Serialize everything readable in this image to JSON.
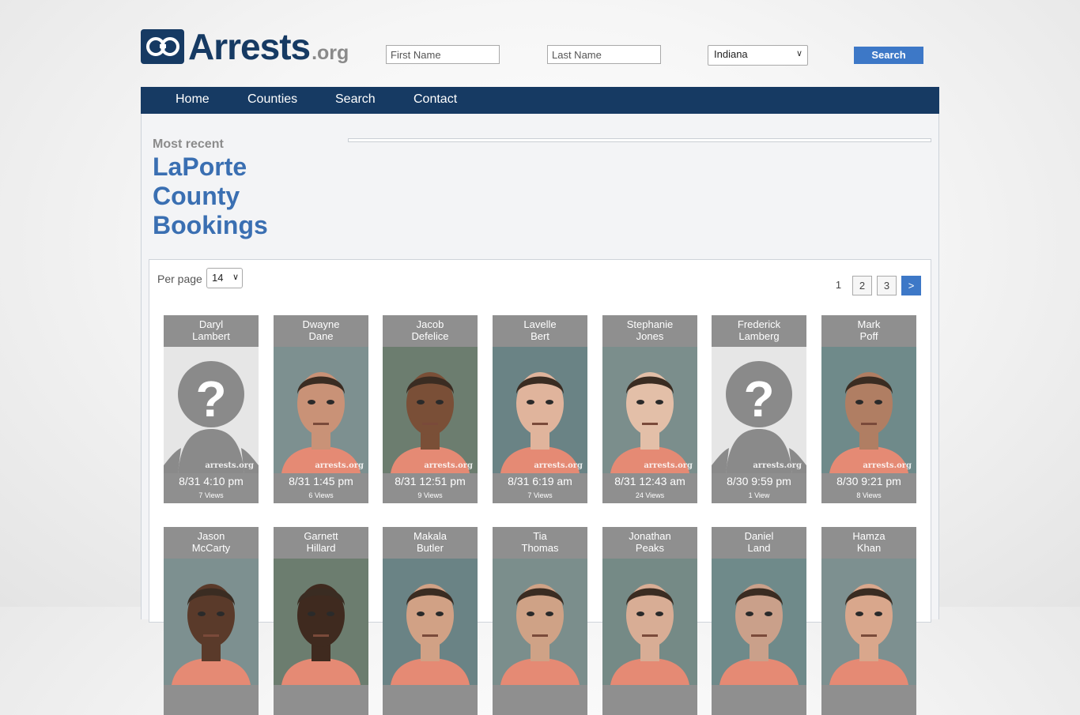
{
  "logo": {
    "main": "Arrests",
    "tld": ".org"
  },
  "search": {
    "first_placeholder": "First Name",
    "last_placeholder": "Last Name",
    "state_selected": "Indiana",
    "button_label": "Search"
  },
  "nav": {
    "items": [
      "Home",
      "Counties",
      "Search",
      "Contact"
    ]
  },
  "heading": {
    "most_recent": "Most recent",
    "title_lines": [
      "LaPorte",
      "County",
      "Bookings"
    ]
  },
  "listing": {
    "per_page_label": "Per page",
    "per_page_value": "14",
    "pagination": [
      "1",
      "2",
      "3",
      ">"
    ]
  },
  "bookings": [
    {
      "first": "Daryl",
      "last": "Lambert",
      "time": "8/31 4:10 pm",
      "views": "7 Views",
      "photo": "placeholder"
    },
    {
      "first": "Dwayne",
      "last": "Dane",
      "time": "8/31 1:45 pm",
      "views": "6 Views",
      "photo": "mugshot"
    },
    {
      "first": "Jacob",
      "last": "Defelice",
      "time": "8/31 12:51 pm",
      "views": "9 Views",
      "photo": "mugshot"
    },
    {
      "first": "Lavelle",
      "last": "Bert",
      "time": "8/31 6:19 am",
      "views": "7 Views",
      "photo": "mugshot"
    },
    {
      "first": "Stephanie",
      "last": "Jones",
      "time": "8/31 12:43 am",
      "views": "24 Views",
      "photo": "mugshot"
    },
    {
      "first": "Frederick",
      "last": "Lamberg",
      "time": "8/30 9:59 pm",
      "views": "1 View",
      "photo": "placeholder"
    },
    {
      "first": "Mark",
      "last": "Poff",
      "time": "8/30 9:21 pm",
      "views": "8 Views",
      "photo": "mugshot"
    },
    {
      "first": "Jason",
      "last": "McCarty",
      "time": "",
      "views": "",
      "photo": "mugshot"
    },
    {
      "first": "Garnett",
      "last": "Hillard",
      "time": "",
      "views": "",
      "photo": "mugshot"
    },
    {
      "first": "Makala",
      "last": "Butler",
      "time": "",
      "views": "",
      "photo": "mugshot"
    },
    {
      "first": "Tia",
      "last": "Thomas",
      "time": "",
      "views": "",
      "photo": "mugshot"
    },
    {
      "first": "Jonathan",
      "last": "Peaks",
      "time": "",
      "views": "",
      "photo": "mugshot"
    },
    {
      "first": "Daniel",
      "last": "Land",
      "time": "",
      "views": "",
      "photo": "mugshot"
    },
    {
      "first": "Hamza",
      "last": "Khan",
      "time": "",
      "views": "",
      "photo": "mugshot"
    }
  ],
  "watermark": "arrests.org",
  "colors": {
    "navy": "#163a63",
    "accent": "#3d78c7",
    "title_blue": "#3a6fb2",
    "card_gray": "#8f8f8f"
  },
  "icons": {
    "logo": "handcuffs-icon",
    "placeholder": "unknown-person-icon"
  }
}
